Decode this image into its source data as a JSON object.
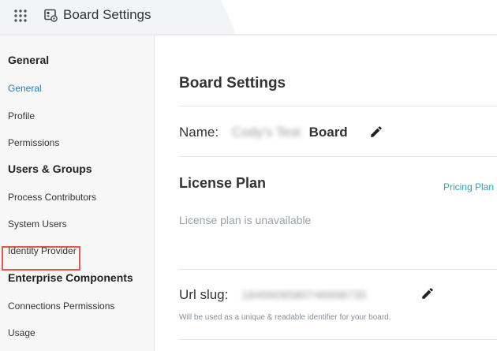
{
  "header": {
    "title": "Board Settings",
    "apps_icon": "apps-grid-icon",
    "board_icon": "board-settings-icon"
  },
  "sidebar": {
    "groups": [
      {
        "heading": "General",
        "items": [
          {
            "label": "General",
            "active": true
          },
          {
            "label": "Profile"
          },
          {
            "label": "Permissions"
          }
        ]
      },
      {
        "heading": "Users & Groups",
        "items": [
          {
            "label": "Process Contributors"
          },
          {
            "label": "System Users",
            "highlighted": true
          },
          {
            "label": "Identity Provider"
          }
        ]
      },
      {
        "heading": "Enterprise Components",
        "items": [
          {
            "label": "Connections Permissions"
          },
          {
            "label": "Usage"
          }
        ]
      }
    ],
    "active_color": "#2a7ab8",
    "highlight_color": "#e3574f"
  },
  "main": {
    "title": "Board Settings",
    "name": {
      "label": "Name:",
      "value_blurred": "Cody's Test",
      "value_suffix": "Board",
      "edit_icon": "pencil-icon"
    },
    "license": {
      "title": "License Plan",
      "link": "Pricing Plan",
      "message": "License plan is unavailable"
    },
    "slug": {
      "label": "Url slug:",
      "value_blurred": "1846609580746998735",
      "hint": "Will be used as a unique & readable identifier for your board.",
      "edit_icon": "pencil-icon"
    }
  }
}
